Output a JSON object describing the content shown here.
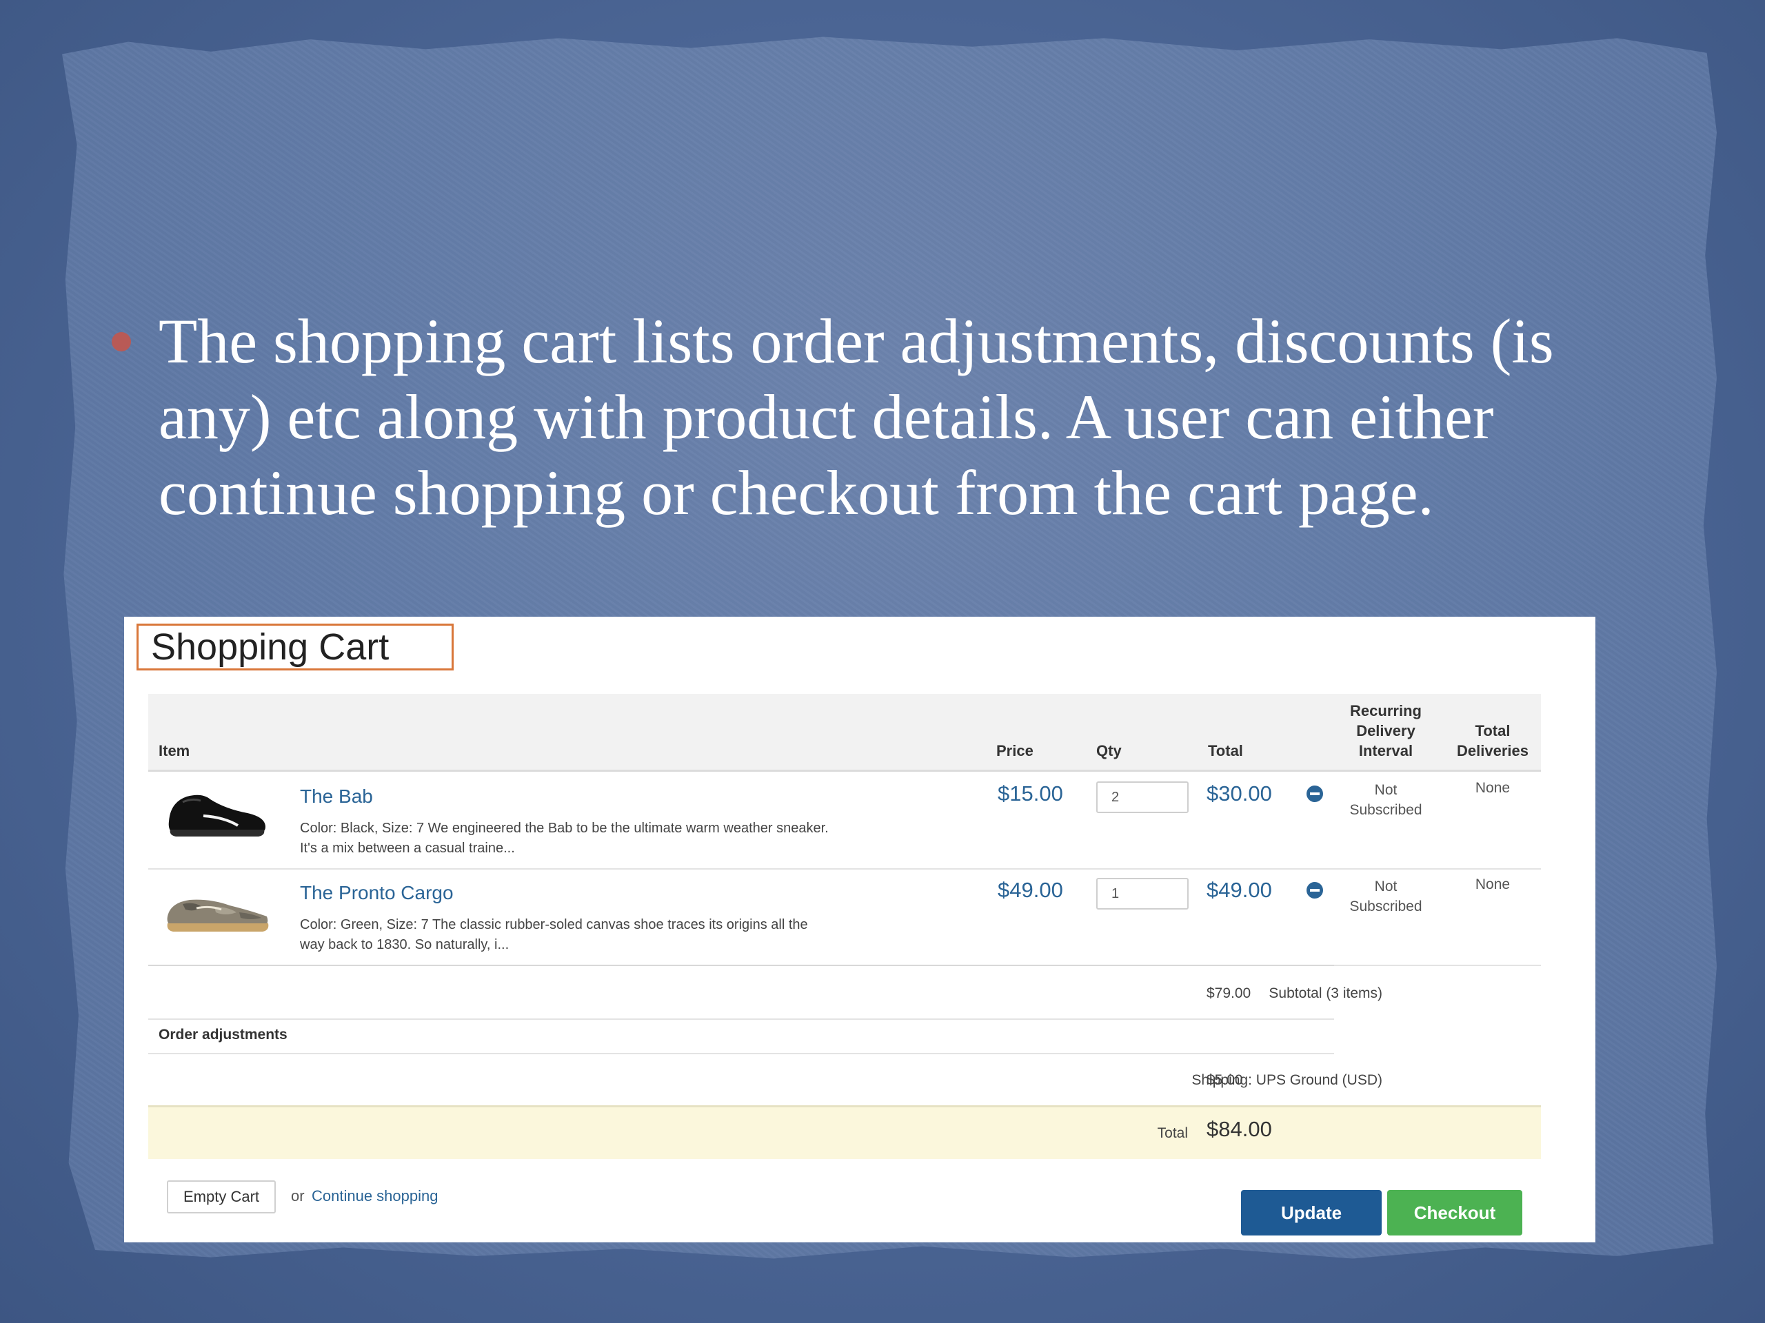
{
  "slide": {
    "bullet_text": "The shopping cart lists order adjustments, discounts (is any) etc along with product details. A user can either continue shopping or checkout from the cart page.",
    "bullet_color": "#c2574e"
  },
  "cart": {
    "title": "Shopping Cart",
    "columns": {
      "item": "Item",
      "price": "Price",
      "qty": "Qty",
      "total": "Total",
      "interval_line1": "Recurring",
      "interval_line2": "Delivery",
      "interval_line3": "Interval",
      "deliveries_line1": "Total",
      "deliveries_line2": "Deliveries"
    },
    "items": [
      {
        "name": "The Bab",
        "image_icon": "black-sneaker-image",
        "description_line1": "Color: Black, Size: 7 We engineered the Bab to be the ultimate warm weather sneaker.",
        "description_line2": "It's a mix between a casual traine...",
        "price": "$15.00",
        "qty": "2",
        "total": "$30.00",
        "interval_line1": "Not",
        "interval_line2": "Subscribed",
        "deliveries": "None"
      },
      {
        "name": "The Pronto Cargo",
        "image_icon": "camo-sneaker-image",
        "description_line1": "Color: Green, Size: 7 The classic rubber-soled canvas shoe traces its origins all the",
        "description_line2": "way back to 1830. So naturally, i...",
        "price": "$49.00",
        "qty": "1",
        "total": "$49.00",
        "interval_line1": "Not",
        "interval_line2": "Subscribed",
        "deliveries": "None"
      }
    ],
    "subtotal_label": "Subtotal (3 items)",
    "subtotal_value": "$79.00",
    "adjustments_label": "Order adjustments",
    "shipping_label": "Shipping: UPS Ground (USD)",
    "shipping_value": "$5.00",
    "total_label": "Total",
    "total_value": "$84.00",
    "empty_cart_label": "Empty Cart",
    "or_text": "or",
    "continue_label": "Continue shopping",
    "update_label": "Update",
    "checkout_label": "Checkout",
    "colors": {
      "link": "#2a6496",
      "update": "#1e5a94",
      "checkout": "#4cb252",
      "title_border": "#d9773a",
      "total_row": "#fbf7dc"
    }
  }
}
